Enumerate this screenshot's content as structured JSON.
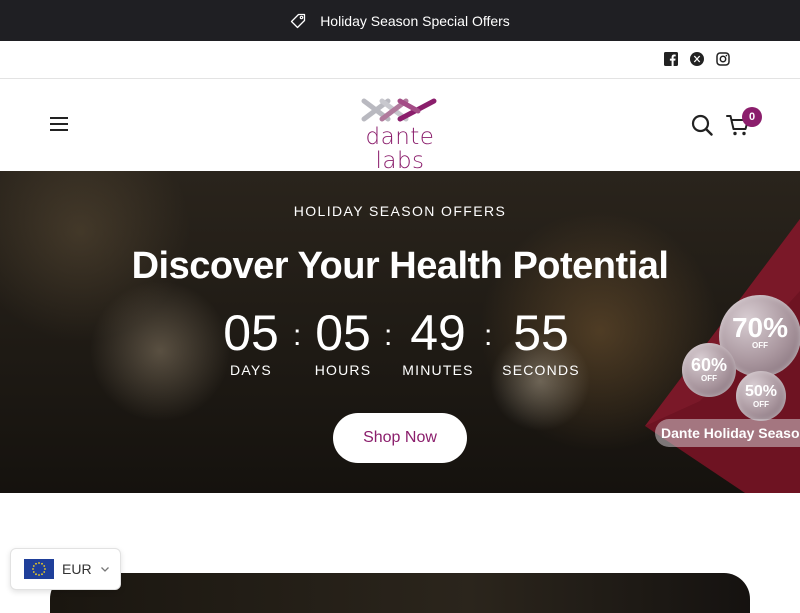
{
  "announcement": {
    "text": "Holiday Season Special Offers",
    "icon": "tag-icon"
  },
  "social": {
    "items": [
      {
        "name": "facebook-icon"
      },
      {
        "name": "x-icon"
      },
      {
        "name": "instagram-icon"
      }
    ]
  },
  "header": {
    "logo_text": "dante labs",
    "menu_icon": "hamburger-icon",
    "search_icon": "search-icon",
    "cart_icon": "cart-icon",
    "cart_count": "0"
  },
  "hero": {
    "eyebrow": "HOLIDAY SEASON OFFERS",
    "title": "Discover Your Health Potential",
    "countdown": {
      "days": "05",
      "days_label": "DAYS",
      "hours": "05",
      "hours_label": "HOURS",
      "minutes": "49",
      "minutes_label": "MINUTES",
      "seconds": "55",
      "seconds_label": "SECONDS",
      "separator": ":"
    },
    "cta_label": "Shop Now",
    "promo": {
      "label": "Dante Holiday Season",
      "badges": [
        {
          "value": "70%",
          "off": "OFF"
        },
        {
          "value": "60%",
          "off": "OFF"
        },
        {
          "value": "50%",
          "off": "OFF"
        }
      ]
    }
  },
  "currency": {
    "code": "EUR",
    "flag_icon": "eu-flag-icon"
  },
  "colors": {
    "brand": "#8b1e6c",
    "announcement_bg": "#1f1f23"
  }
}
